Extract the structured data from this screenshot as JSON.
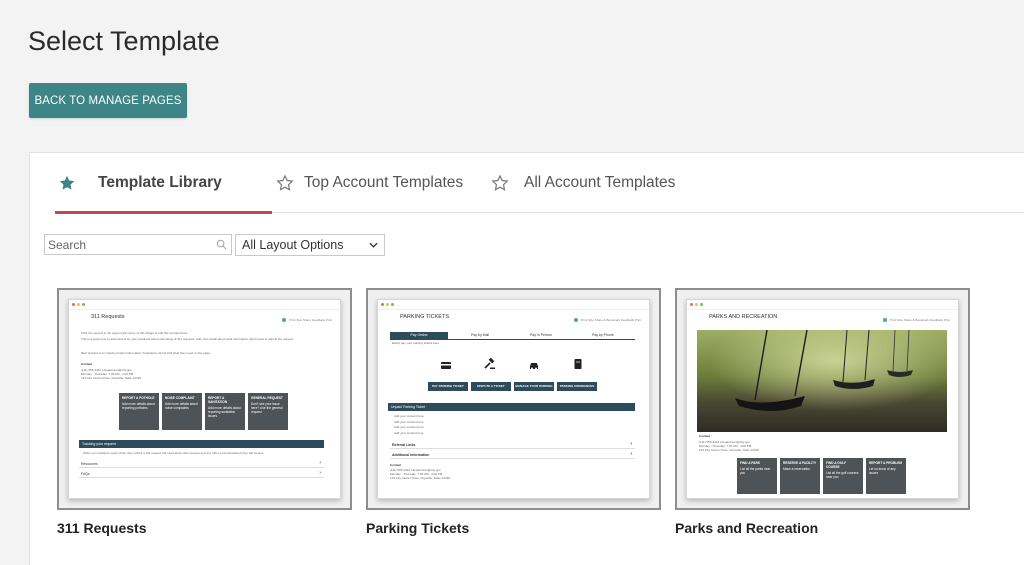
{
  "page": {
    "title": "Select Template",
    "back_button": "BACK TO MANAGE PAGES"
  },
  "tabs": [
    {
      "label": "Template Library",
      "icon": "star-filled-icon",
      "active": true
    },
    {
      "label": "Top Account Templates",
      "icon": "star-outline-icon",
      "active": false
    },
    {
      "label": "All Account Templates",
      "icon": "star-outline-icon",
      "active": false
    }
  ],
  "filters": {
    "search_placeholder": "Search",
    "layout_select": "All Layout Options"
  },
  "templates": [
    {
      "name": "311 Requests",
      "preview": {
        "title": "311 Requests",
        "tools": "Print Size  Share  Feedback  Print",
        "intro1": "Click the second in the upper right corner of this widget to edit this Content Area.",
        "intro2": "This is a great spot to add content for your residents about submitting of 311 requests. Add more detail about what information they'll need to submit the request.",
        "intro3": "Best practice is to include contact information if residents cannot find what they need on the page.",
        "contact_label": "Contact",
        "contact": "(111) 555-4444 | department@city.gov\nMonday - Thursday: 7:00 AM - 4:00 PM\n123 City Center Drive, Citysville, State 12345",
        "tiles": [
          {
            "title": "REPORT A POTHOLE",
            "text": "Add more details about reporting potholes"
          },
          {
            "title": "NOISE COMPLAINT",
            "text": "Add more details about noise complaints"
          },
          {
            "title": "REPORT A SANITATION",
            "text": "Add more details about reporting sanitation issues"
          },
          {
            "title": "GENERAL REQUEST",
            "text": "Don't see your issue here? Use the general request"
          }
        ],
        "accordion_open": "Tracking your request",
        "accordion_text": "When you residents report when they submit a 311 request will need about their request and any other communications they will receive.",
        "accordion_rows": [
          "Resources",
          "FAQs"
        ]
      }
    },
    {
      "name": "Parking Tickets",
      "preview": {
        "title": "PARKING TICKETS",
        "tools": "Print Size  Share & Bookmark  Feedback  Print",
        "tabs": [
          "Pay Online",
          "Pay by Mail",
          "Pay in Person",
          "Pay by Phone"
        ],
        "tab_text": "Easily pay your parking tickets here",
        "buttons": [
          "PAY PARKING TICKET",
          "DISPUTE A TICKET",
          "MANAGE YOUR PARKING",
          "PARKING ORDINANCES"
        ],
        "accordion_open": "Unpaid Parking Ticket",
        "accordion_lines": [
          "Add your content here",
          "Add your content here",
          "Add your content here",
          "Add your content here"
        ],
        "accordion_rows": [
          "Referral Links",
          "Additional Information"
        ],
        "contact_label": "Contact",
        "contact": "(111) 555-4444 | department@city.gov\nMonday - Thursday: 7:00 AM - 4:00 PM\n123 City Center Drive, Citysville, State 12345"
      }
    },
    {
      "name": "Parks and Recreation",
      "preview": {
        "title": "PARKS AND RECREATION",
        "tools": "Print Size  Share & Bookmark  Feedback  Print",
        "contact_label": "Contact",
        "contact": "(111) 555-4444 | department@city.gov\nMonday - Thursday: 7:00 AM - 4:00 PM\n123 City Center Drive, Citysville, State 12345",
        "tiles": [
          {
            "title": "FIND A PARK",
            "text": "List all the parks near you"
          },
          {
            "title": "RESERVE A FACILITY",
            "text": "Make a reservation"
          },
          {
            "title": "FIND A GOLF COURSE",
            "text": "List all the golf courses near you"
          },
          {
            "title": "REPORT A PROBLEM",
            "text": "Let us know of any issues"
          }
        ]
      }
    }
  ],
  "colors": {
    "accent": "#3d8587",
    "tab_underline": "#c0464f",
    "tile": "#4e5358",
    "navy": "#2d4b5a"
  }
}
